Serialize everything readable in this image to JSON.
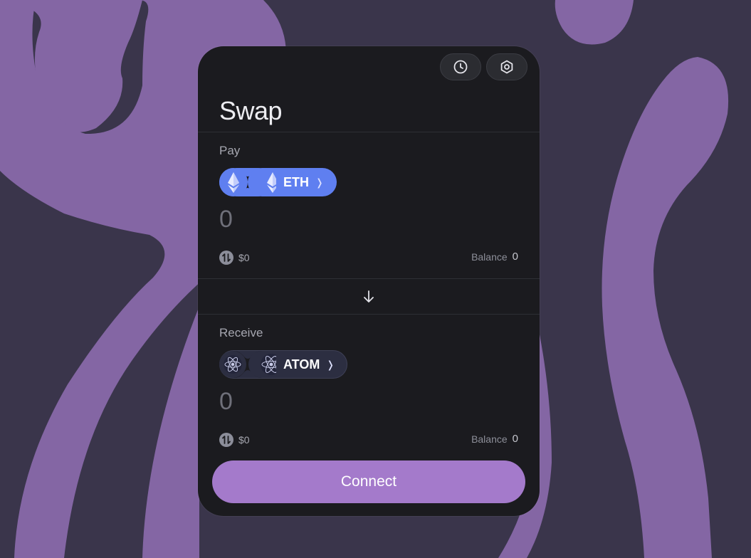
{
  "colors": {
    "background": "#3a354b",
    "blob": "#8466a4",
    "card": "#1b1b1f",
    "eth_pill": "#5f7ff0",
    "atom_pill": "#2c2e41",
    "connect_button": "#a47acb"
  },
  "header": {
    "history_icon": "clock-icon",
    "settings_icon": "gear-icon",
    "title": "Swap"
  },
  "pay": {
    "label": "Pay",
    "token_symbol": "ETH",
    "token_icon": "ethereum-icon",
    "amount_placeholder": "0",
    "usd_value": "$0",
    "balance_label": "Balance",
    "balance_value": "0"
  },
  "flip_icon": "arrow-down-icon",
  "receive": {
    "label": "Receive",
    "token_symbol": "ATOM",
    "token_icon": "cosmos-atom-icon",
    "amount_placeholder": "0",
    "usd_value": "$0",
    "balance_label": "Balance",
    "balance_value": "0"
  },
  "connect_label": "Connect"
}
